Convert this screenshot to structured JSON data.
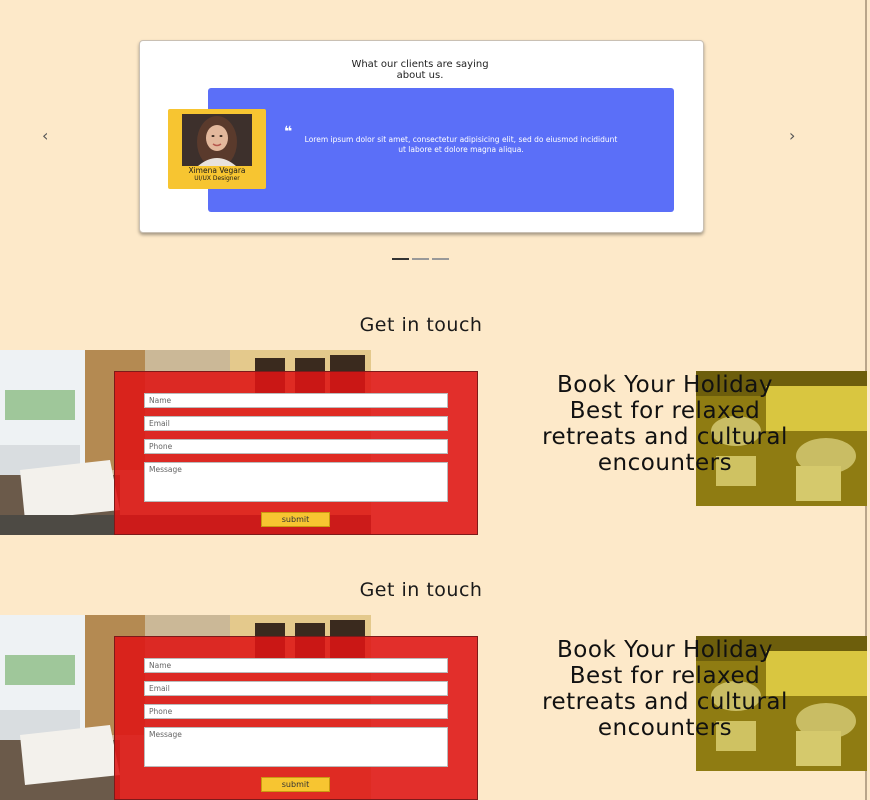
{
  "testimonial": {
    "heading": "What our clients are saying about us.",
    "quote_mark": "❝",
    "quote": "Lorem ipsum dolor sit amet, consectetur adipisicing elit, sed do eiusmod incididunt ut labore et dolore magna aliqua.",
    "name": "Ximena Vegara",
    "role": "UI/UX Designer",
    "prev_icon": "‹",
    "next_icon": "›",
    "slides": 3,
    "active_slide": 1
  },
  "contact_sections": [
    {
      "title": "Get in touch",
      "fields": {
        "name": "Name",
        "email": "Email",
        "phone": "Phone",
        "message": "Message"
      },
      "submit": "submit",
      "book_text": "Book Your Holiday Best for relaxed retreats and cultural encounters"
    },
    {
      "title": "Get in touch",
      "fields": {
        "name": "Name",
        "email": "Email",
        "phone": "Phone",
        "message": "Message"
      },
      "submit": "submit",
      "book_text": "Book Your Holiday Best for relaxed retreats and cultural encounters"
    }
  ],
  "colors": {
    "page_bg": "#fde9c9",
    "quote_panel": "#5b6ff8",
    "person_card": "#f7c531",
    "form_overlay": "#de1414",
    "submit_button": "#f7c531"
  }
}
